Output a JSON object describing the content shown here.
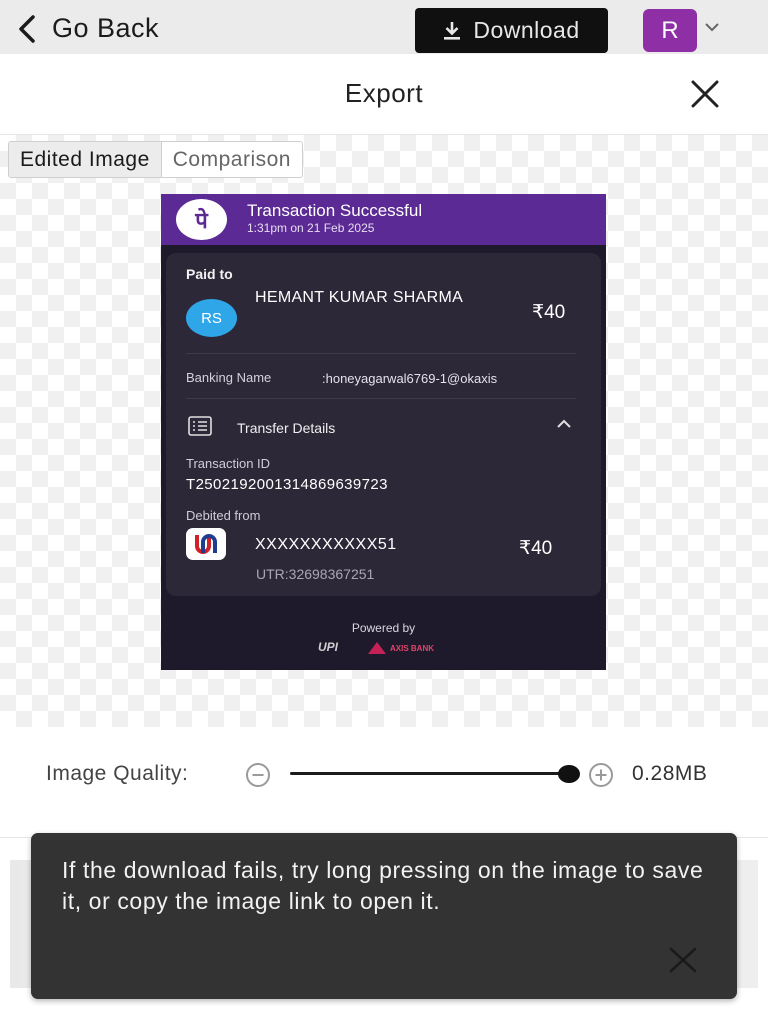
{
  "topbar": {
    "back_label": "Go Back",
    "download_label": "Download",
    "avatar_initial": "R",
    "avatar_color": "#8f2fa6"
  },
  "export": {
    "title": "Export"
  },
  "tabs": [
    {
      "label": "Edited Image",
      "active": true
    },
    {
      "label": "Comparison",
      "active": false
    }
  ],
  "receipt": {
    "status_title": "Transaction Successful",
    "timestamp": "1:31pm on 21 Feb 2025",
    "paid_to_label": "Paid to",
    "payee_initials": "RS",
    "payee_name": "HEMANT KUMAR SHARMA",
    "amount": "₹40",
    "banking_name_label": "Banking Name",
    "banking_name_value": ":honeyagarwal6769-1@okaxis",
    "transfer_details_label": "Transfer Details",
    "transaction_id_label": "Transaction ID",
    "transaction_id_value": "T2502192001314869639723",
    "debited_from_label": "Debited from",
    "account_masked": "XXXXXXXXXXX51",
    "debit_amount": "₹40",
    "utr": "UTR:32698367251",
    "powered_by": "Powered by",
    "upi_logo_text": "UPI",
    "axis_bank_text": "AXIS BANK",
    "header_color": "#5c2a94"
  },
  "quality": {
    "label": "Image Quality:",
    "level": 0.97,
    "file_size": "0.28MB"
  },
  "toast": {
    "message": "If the download fails, try long pressing on the image to save it, or copy the image link to open it."
  }
}
